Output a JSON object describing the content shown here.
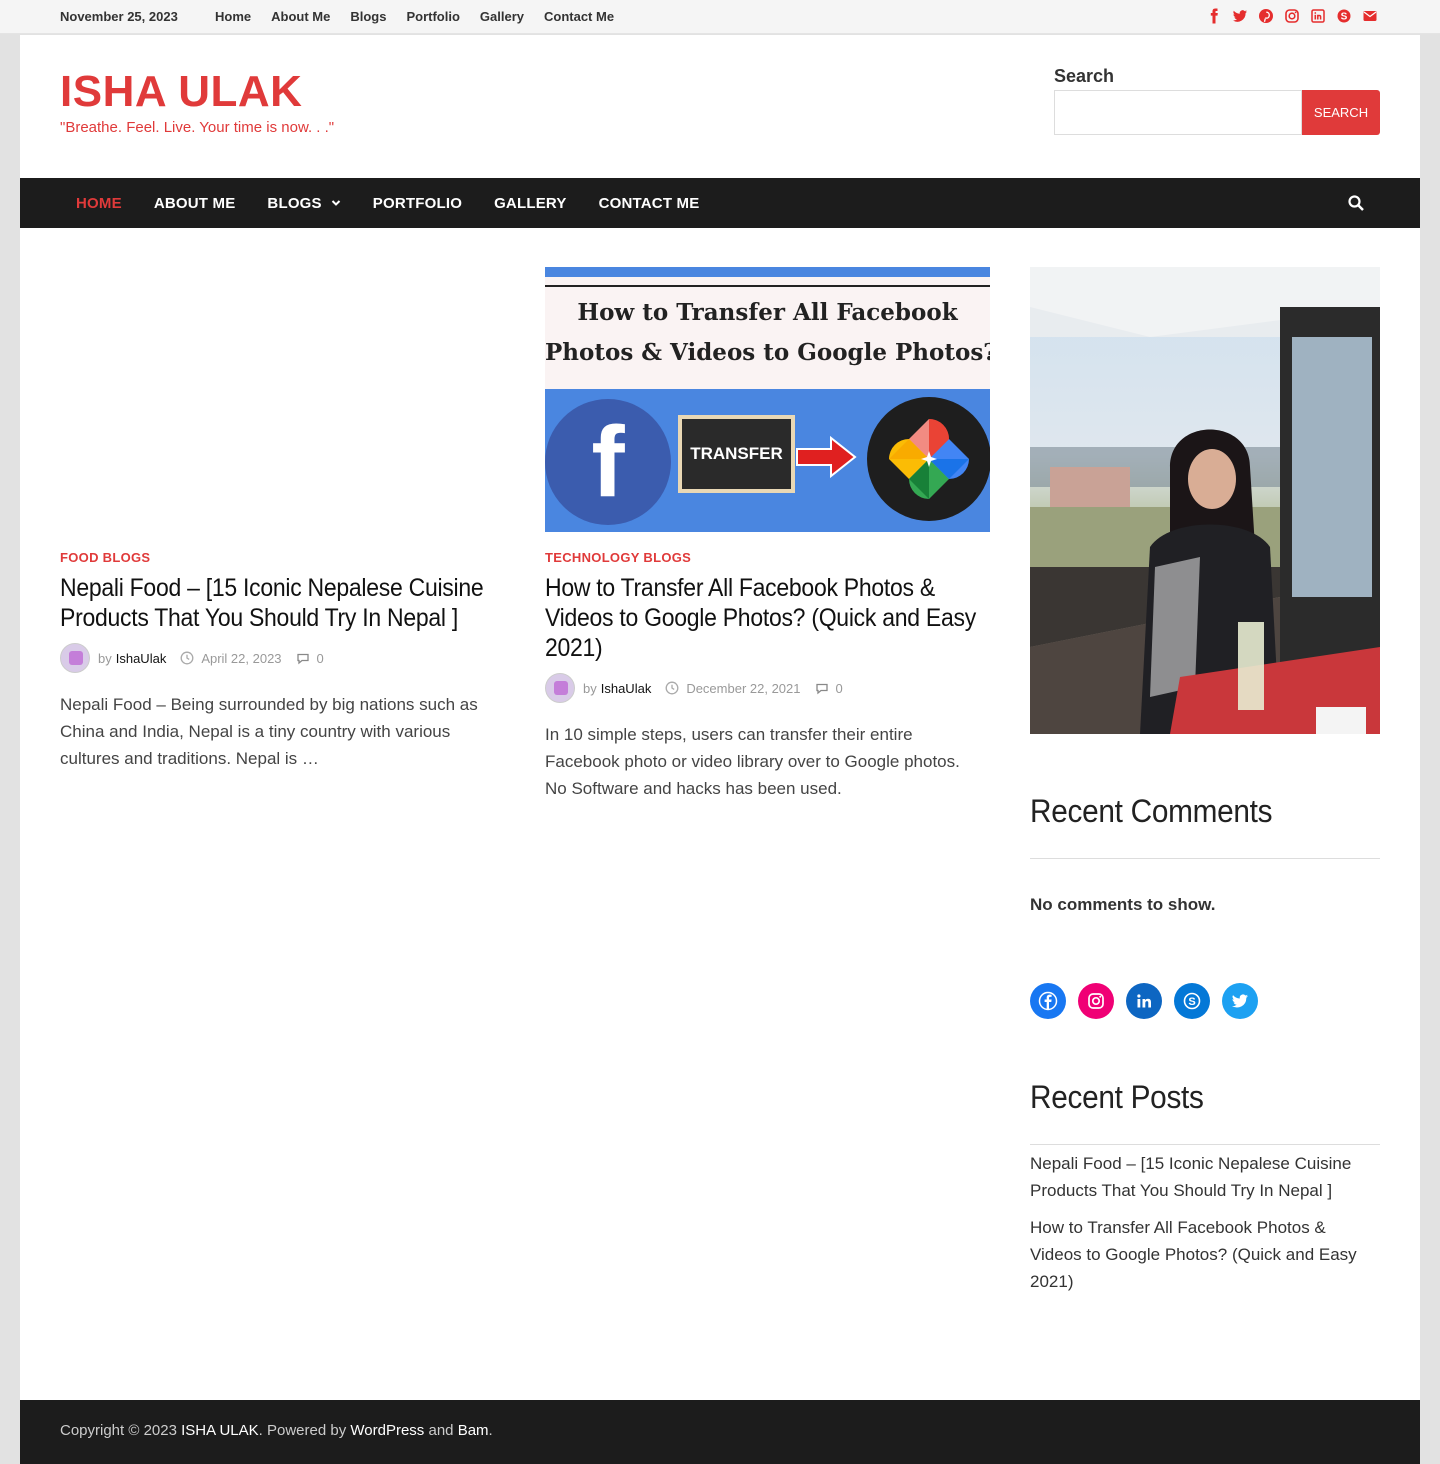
{
  "topbar": {
    "date": "November 25, 2023",
    "nav": [
      "Home",
      "About Me",
      "Blogs",
      "Portfolio",
      "Gallery",
      "Contact Me"
    ],
    "social_icons": [
      "facebook-icon",
      "twitter-icon",
      "pinterest-icon",
      "instagram-icon",
      "linkedin-icon",
      "skype-icon",
      "email-icon"
    ]
  },
  "header": {
    "site_title": "ISHA ULAK",
    "tagline": "\"Breathe. Feel. Live. Your time is now. . .\"",
    "search_label": "Search",
    "search_value": "",
    "search_button": "SEARCH"
  },
  "mainnav": {
    "items": [
      "HOME",
      "ABOUT ME",
      "BLOGS",
      "PORTFOLIO",
      "GALLERY",
      "CONTACT ME"
    ],
    "active": "HOME"
  },
  "posts": [
    {
      "category": "FOOD BLOGS",
      "title": "Nepali Food – [15 Iconic Nepalese Cuisine Products That You Should Try In Nepal ]",
      "by": "by",
      "author": "IshaUlak",
      "date": "April 22, 2023",
      "comments": "0",
      "excerpt": "Nepali Food – Being surrounded by big nations such as China and India, Nepal is a tiny country with various cultures and traditions. Nepal is …"
    },
    {
      "category": "TECHNOLOGY BLOGS",
      "title": "How to Transfer All Facebook Photos & Videos to Google Photos? (Quick and Easy 2021)",
      "by": "by",
      "author": "IshaUlak",
      "date": "December 22, 2021",
      "comments": "0",
      "excerpt": "In 10 simple steps, users can transfer their entire Facebook photo or video library over to Google photos. No Software and hacks has been used.",
      "thumb_line1": "How to Transfer All Facebook",
      "thumb_line2": "Photos & Videos to Google Photos?",
      "thumb_board": "TRANSFER",
      "thumb_fb": "f"
    }
  ],
  "sidebar": {
    "recent_comments_title": "Recent Comments",
    "no_comments": "No comments to show.",
    "social": [
      {
        "icon": "facebook-icon",
        "color": "#1877f2"
      },
      {
        "icon": "instagram-icon",
        "color": "#f00075"
      },
      {
        "icon": "linkedin-icon",
        "color": "#0d66c2"
      },
      {
        "icon": "skype-icon",
        "color": "#0478d7"
      },
      {
        "icon": "twitter-icon",
        "color": "#1da1f2"
      }
    ],
    "recent_posts_title": "Recent Posts",
    "recent_posts": [
      "Nepali Food – [15 Iconic Nepalese Cuisine Products That You Should Try In Nepal ]",
      "How to Transfer All Facebook Photos & Videos to Google Photos? (Quick and Easy 2021)"
    ]
  },
  "footer": {
    "prefix": "Copyright © 2023 ",
    "site": "ISHA ULAK",
    "middle": ". Powered by ",
    "wordpress": "WordPress",
    "and": " and ",
    "theme": "Bam",
    "suffix": "."
  },
  "colors": {
    "accent": "#e03a3a",
    "nav_bg": "#1c1c1c"
  }
}
